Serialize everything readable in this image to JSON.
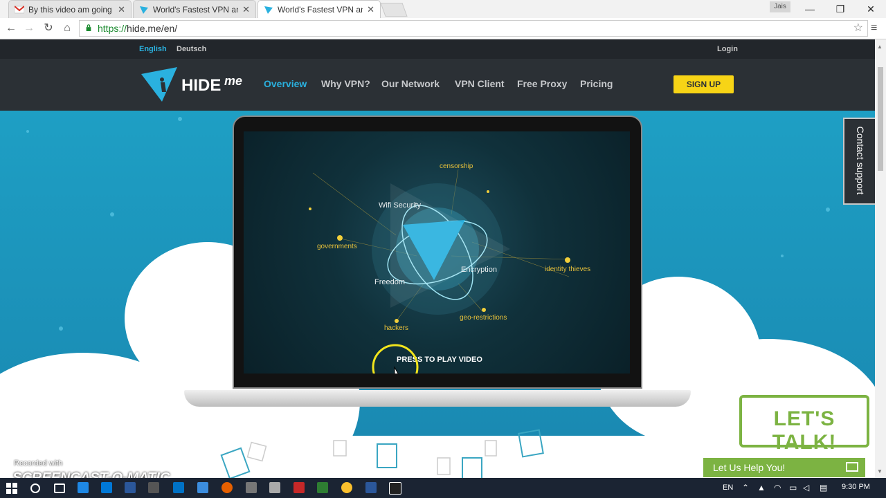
{
  "browser": {
    "tabs": [
      {
        "title": "By this video am going to",
        "icon": "gmail-icon"
      },
      {
        "title": "World's Fastest VPN and F",
        "icon": "hideme-icon"
      },
      {
        "title": "World's Fastest VPN and F",
        "icon": "hideme-icon",
        "active": true
      }
    ],
    "user_badge": "Jais",
    "url_scheme": "https://",
    "url_rest": "hide.me/en/"
  },
  "site": {
    "languages": [
      "English",
      "Deutsch"
    ],
    "active_language": "English",
    "login": "Login",
    "logo_text": "HIDE",
    "logo_suffix": "me",
    "nav": [
      "Overview",
      "Why VPN?",
      "Our Network",
      "VPN Client",
      "Free Proxy",
      "Pricing"
    ],
    "active_nav": "Overview",
    "signup": "SIGN UP",
    "contact_support": "Contact support",
    "lets_talk": "LET'S TALK!",
    "help": "Let Us Help You!"
  },
  "video": {
    "threats": [
      "censorship",
      "governments",
      "identity thieves",
      "hackers",
      "geo-restrictions"
    ],
    "features": [
      "Wifi Security",
      "Encryption",
      "Freedom"
    ],
    "play_label": "PRESS TO PLAY VIDEO"
  },
  "overlay": {
    "recorded": "Recorded with",
    "brand": "SCREENCAST-O-MATIC"
  },
  "taskbar": {
    "lang": "EN",
    "time": "9:30 PM"
  },
  "colors": {
    "accent": "#2ab1df",
    "signup": "#f7d416",
    "help_green": "#7cb342",
    "nav_bg": "#2b3035"
  }
}
